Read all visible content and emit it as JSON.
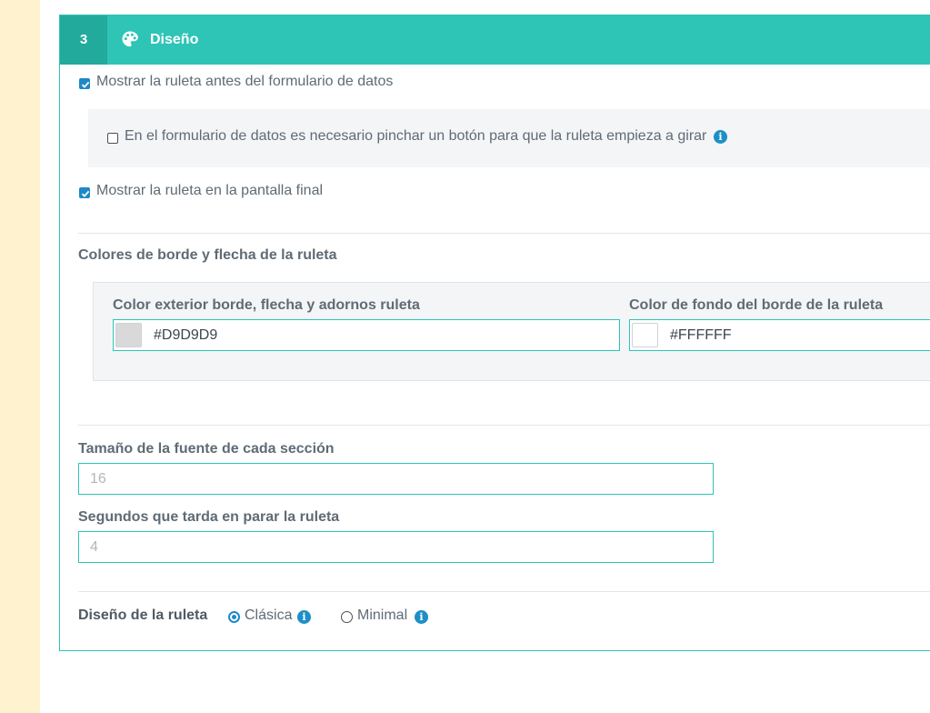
{
  "section": {
    "number": "3",
    "icon": "palette-icon",
    "title": "Diseño"
  },
  "options": {
    "show_before_form": {
      "label": "Mostrar la ruleta antes del formulario de datos",
      "checked": true
    },
    "require_button": {
      "label": "En el formulario de datos es necesario pinchar un botón para que la ruleta empieza a girar",
      "checked": false,
      "info_icon": "info-icon"
    },
    "show_final_screen": {
      "label": "Mostrar la ruleta en la pantalla final",
      "checked": true
    }
  },
  "colors": {
    "heading": "Colores de borde y flecha de la ruleta",
    "outer": {
      "label": "Color exterior borde, flecha y adornos ruleta",
      "value": "#D9D9D9"
    },
    "background": {
      "label": "Color de fondo del borde de la ruleta",
      "value": "#FFFFFF"
    }
  },
  "font_size": {
    "label": "Tamaño de la fuente de cada sección",
    "value": "16"
  },
  "stop_seconds": {
    "label": "Segundos que tarda en parar la ruleta",
    "value": "4"
  },
  "design": {
    "label": "Diseño de la ruleta",
    "options": [
      {
        "label": "Clásica",
        "selected": true
      },
      {
        "label": "Minimal",
        "selected": false
      }
    ]
  },
  "theme": {
    "accent": "#2ec4b6",
    "accent_dark": "#22aa9c",
    "check": "#1e88c8",
    "page_side": "#fff3cf"
  }
}
